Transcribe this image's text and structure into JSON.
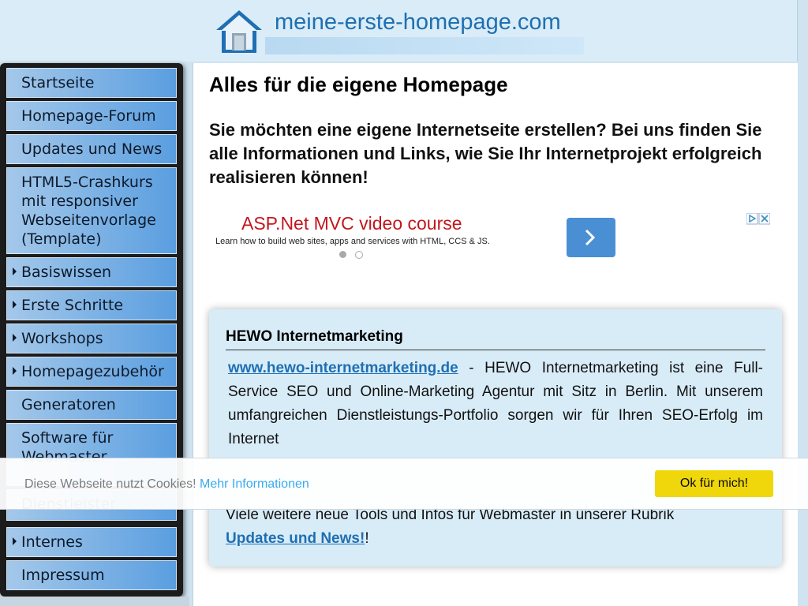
{
  "header": {
    "site_title": "meine-erste-homepage.com"
  },
  "sidebar": {
    "items": [
      {
        "label": "Startseite",
        "has_arrow": false
      },
      {
        "label": "Homepage-Forum",
        "has_arrow": false
      },
      {
        "label": "Updates und News",
        "has_arrow": false
      },
      {
        "label": "HTML5-Crashkurs mit responsiver Webseitenvorlage (Template)",
        "has_arrow": false
      },
      {
        "label": "Basiswissen",
        "has_arrow": true
      },
      {
        "label": "Erste Schritte",
        "has_arrow": true
      },
      {
        "label": "Workshops",
        "has_arrow": true
      },
      {
        "label": "Homepagezubehör",
        "has_arrow": true
      },
      {
        "label": "Generatoren",
        "has_arrow": false
      },
      {
        "label": "Software für Webmaster",
        "has_arrow": false
      },
      {
        "label": "Dienstleister",
        "has_arrow": false
      },
      {
        "label": "Internes",
        "has_arrow": true
      },
      {
        "label": "Impressum",
        "has_arrow": false
      }
    ]
  },
  "main": {
    "title": "Alles für die eigene Homepage",
    "intro": "Sie möchten eine eigene Internetseite erstellen? Bei uns finden Sie alle Informationen und Links, wie Sie Ihr Internetprojekt erfolgreich realisieren können!"
  },
  "ad": {
    "headline": "ASP.Net MVC video course",
    "subline": "Learn how to build web sites, apps and services with HTML, CCS & JS."
  },
  "infobox": {
    "title": "HEWO Internetmarketing",
    "link_text": "www.hewo-internetmarketing.de",
    "description": " - HEWO Internetmarketing ist eine Full-Service SEO und Online-Marketing Agentur mit Sitz in Berlin. Mit unserem umfangreichen Dienstleistungs-Portfolio sorgen wir für Ihren SEO-Erfolg im Internet",
    "bottom_text": "Viele weitere neue Tools und Infos für Webmaster in unserer Rubrik ",
    "bottom_link": "Updates und News!",
    "bottom_suffix": "!"
  },
  "cookie": {
    "text": "Diese Webseite nutzt Cookies! ",
    "more_link": "Mehr Informationen",
    "accept_button": "Ok für mich!"
  },
  "colors": {
    "accent": "#1f6fb2",
    "cookie_button": "#f1d600",
    "ad_button": "#4a8fd4"
  }
}
